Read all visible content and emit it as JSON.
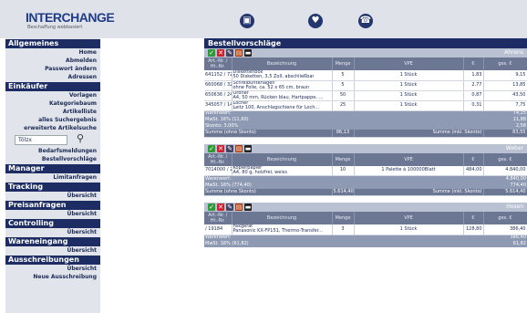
{
  "header": {
    "logo": "INTERCHANGE",
    "logo_sub": "Beschaffung webbasiert",
    "icons": [
      "shopping-icon",
      "heart-icon",
      "phone-icon"
    ]
  },
  "sidebar": {
    "sections": [
      {
        "title": "Allgemeines",
        "items": [
          "Home",
          "Abmelden",
          "Passwort ändern",
          "Adressen"
        ]
      },
      {
        "title": "Einkäufer",
        "items": [
          "Vorlagen",
          "Kategoriebaum",
          "Artikelliste",
          "alles Suchergebnis",
          "erweiterte Artikelsuche"
        ]
      }
    ],
    "search_value": "Tölzx",
    "after_search": [
      "Bedarfsmeldungen",
      "Bestellvorschläge"
    ],
    "sections2": [
      {
        "title": "Manager",
        "items": [
          "Limitanfragen"
        ]
      },
      {
        "title": "Tracking",
        "items": [
          "Übersicht"
        ]
      },
      {
        "title": "Preisanfragen",
        "items": [
          "Übersicht"
        ]
      },
      {
        "title": "Controlling",
        "items": [
          "Übersicht"
        ]
      },
      {
        "title": "Wareneingang",
        "items": [
          "Übersicht"
        ]
      },
      {
        "title": "Ausschreibungen",
        "items": [
          "Übersicht",
          "Neue Ausschreibung"
        ]
      }
    ]
  },
  "main": {
    "title": "Bestellvorschläge",
    "columns": [
      "Art.-Nr. / Ht.-Nr.",
      "Bezeichnung",
      "Menge",
      "VPE",
      "€",
      "ges. €"
    ],
    "blocks": [
      {
        "supplier": "Ahrens",
        "rows": [
          [
            "641152 / 72",
            "Diskettenbox",
            "50 Disketten, 3,5 Zoll, abschließbar",
            "5",
            "1 Stück",
            "1,83",
            "9,15"
          ],
          [
            "660068 / 3278",
            "Schreibunterlagen",
            "ohne Folie, ca. 52 x 65 cm, braun",
            "5",
            "1 Stück",
            "2,77",
            "13,85"
          ],
          [
            "650636 / 2402",
            "Ordner",
            "A4, 50 mm, Rücken blau, Hartpappe, ...",
            "50",
            "1 Stück",
            "0,87",
            "43,50"
          ],
          [
            "345057 / 14675",
            "Locher",
            "Leitz 100, Anschlagschiene für Loch...",
            "25",
            "1 Stück",
            "0,31",
            "7,75"
          ]
        ],
        "summary": [
          "Warenwert:",
          "MwSt. 16% (11,60)",
          "Skonto: 3,00%"
        ],
        "summary_values": [
          "74,25",
          "11,88",
          "2,58"
        ],
        "total_label": "Summe",
        "total_label_sub": "(ohne Skonto)",
        "total_value": "86,13",
        "total_label2": "Summe",
        "total_label2_sub": "(inkl. Skonto)",
        "total_value2": "83,55"
      },
      {
        "supplier": "Weber",
        "rows": [
          [
            "7014000 / 2414",
            "Kopierpapier",
            "A4, 80 g, holzfrei, weiss",
            "10",
            "1 Palette à 100000Blatt",
            "484,00",
            "4.840,00"
          ]
        ],
        "summary": [
          "Warenwert:",
          "MwSt. 16% (774,40)"
        ],
        "summary_values": [
          "4.840,00",
          "774,40"
        ],
        "total_label": "Summe",
        "total_label_sub": "(ohne Skonto)",
        "total_value": "5.614,40",
        "total_label2": "Summe",
        "total_label2_sub": "(inkl. Skonto)",
        "total_value2": "5.614,40"
      },
      {
        "supplier": "Hosen",
        "rows": [
          [
            "/ 19184",
            "Faxgerät",
            "Panasonic KX-FP151, Thermo-Transfer...",
            "3",
            "1 Stück",
            "128,80",
            "386,40"
          ]
        ],
        "summary": [
          "Warenwert:",
          "MwSt. 16% (61,82)"
        ],
        "summary_values": [
          "386,40",
          "61,82"
        ]
      }
    ]
  }
}
